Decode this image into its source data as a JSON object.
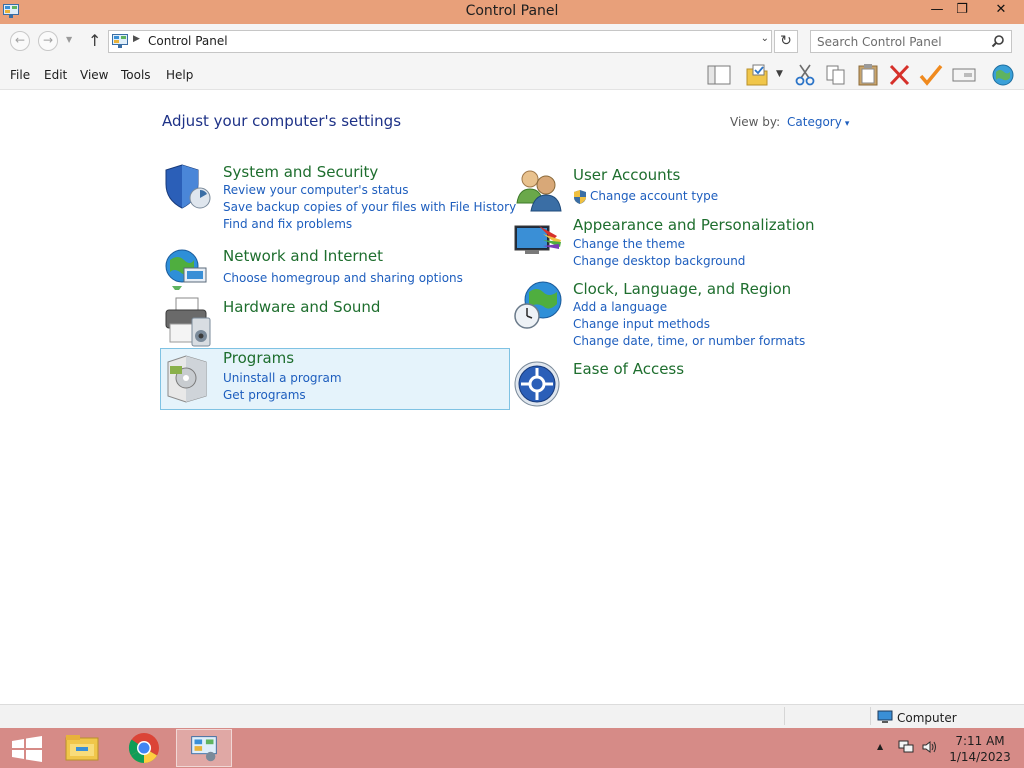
{
  "window": {
    "title": "Control Panel",
    "minimize_glyph": "—",
    "maximize_glyph": "❐",
    "close_glyph": "✕"
  },
  "address_bar": {
    "back_glyph": "←",
    "forward_glyph": "→",
    "recent_glyph": "▼",
    "up_glyph": "↑",
    "breadcrumb_arrow": "▶",
    "breadcrumb": "Control Panel",
    "dropdown_glyph": "⌄",
    "refresh_glyph": "↻",
    "search_placeholder": "Search Control Panel"
  },
  "menu": [
    "File",
    "Edit",
    "View",
    "Tools",
    "Help"
  ],
  "toolbar": {
    "icons": [
      "layout-pane-icon",
      "checked-folder-icon",
      "cut-icon",
      "copy-icon",
      "paste-icon",
      "delete-icon",
      "checkmark-icon",
      "properties-icon",
      "globe-icon"
    ],
    "dropdown_glyph": "▼"
  },
  "main": {
    "heading": "Adjust your computer's settings",
    "view_by_label": "View by:",
    "view_by_value": "Category",
    "view_by_arrow": "▾",
    "left_categories": [
      {
        "icon": "shield-icon",
        "title": "System and Security",
        "links": [
          "Review your computer's status",
          "Save backup copies of your files with File History",
          "Find and fix problems"
        ]
      },
      {
        "icon": "network-globe-icon",
        "title": "Network and Internet",
        "links": [
          "Choose homegroup and sharing options"
        ]
      },
      {
        "icon": "printer-speaker-icon",
        "title": "Hardware and Sound",
        "links": []
      },
      {
        "icon": "programs-box-icon",
        "title": "Programs",
        "links": [
          "Uninstall a program",
          "Get programs"
        ],
        "highlighted": true
      }
    ],
    "right_categories": [
      {
        "icon": "users-icon",
        "title": "User Accounts",
        "links": [
          "Change account type"
        ]
      },
      {
        "icon": "monitor-paint-icon",
        "title": "Appearance and Personalization",
        "links": [
          "Change the theme",
          "Change desktop background"
        ]
      },
      {
        "icon": "clock-globe-icon",
        "title": "Clock, Language, and Region",
        "links": [
          "Add a language",
          "Change input methods",
          "Change date, time, or number formats"
        ]
      },
      {
        "icon": "ease-of-access-icon",
        "title": "Ease of Access",
        "links": []
      }
    ]
  },
  "status_bar": {
    "location": "Computer"
  },
  "taskbar": {
    "apps": [
      "windows-start-icon",
      "file-explorer-icon",
      "chrome-icon",
      "control-panel-icon"
    ],
    "tray_arrow": "▲",
    "time": "7:11 AM",
    "date": "1/14/2023"
  },
  "colors": {
    "title_bar": "#e8a07a",
    "taskbar": "#d68b87",
    "category_title": "#1e6e2e",
    "link": "#1e5ebe",
    "heading": "#1e3287",
    "highlight_bg": "#e5f3fb",
    "highlight_border": "#7fc2e3"
  }
}
